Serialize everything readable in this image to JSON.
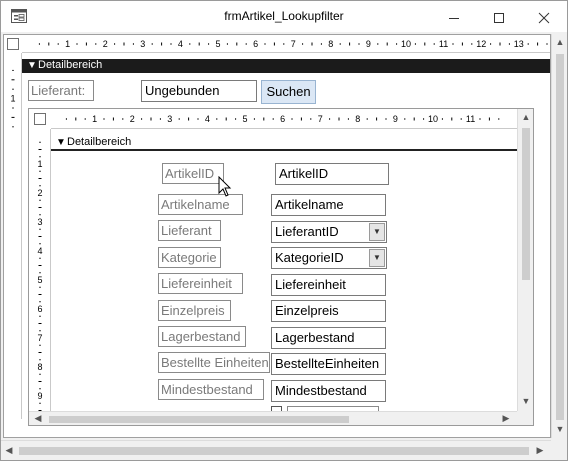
{
  "window": {
    "title": "frmArtikel_Lookupfilter",
    "app_icon": "form-icon",
    "minimize_icon": "minimize-icon",
    "maximize_icon": "maximize-icon",
    "close_icon": "close-icon"
  },
  "outer": {
    "section_label": "Detailbereich",
    "filter_label": "Lieferant:",
    "filter_value": "Ungebunden",
    "search_button": "Suchen",
    "ruler_numbers": [
      "1",
      "2",
      "3",
      "4",
      "5",
      "6",
      "7",
      "8",
      "9",
      "10",
      "11",
      "12",
      "13"
    ]
  },
  "subform": {
    "section_label": "Detailbereich",
    "ruler_numbers": [
      "1",
      "2",
      "3",
      "4",
      "5",
      "6",
      "7",
      "8",
      "9",
      "10",
      "11"
    ],
    "vertical_ruler_numbers": [
      "1",
      "2",
      "3",
      "4",
      "5",
      "6",
      "7",
      "8",
      "9"
    ],
    "fields": [
      {
        "label": "ArtikelID",
        "control": "ArtikelID",
        "type": "textbox"
      },
      {
        "label": "Artikelname",
        "control": "Artikelname",
        "type": "textbox"
      },
      {
        "label": "Lieferant",
        "control": "LieferantID",
        "type": "combobox"
      },
      {
        "label": "Kategorie",
        "control": "KategorieID",
        "type": "combobox"
      },
      {
        "label": "Liefereinheit",
        "control": "Liefereinheit",
        "type": "textbox"
      },
      {
        "label": "Einzelpreis",
        "control": "Einzelpreis",
        "type": "textbox"
      },
      {
        "label": "Lagerbestand",
        "control": "Lagerbestand",
        "type": "textbox"
      },
      {
        "label": "Bestellte Einheiten",
        "control": "BestellteEinheiten",
        "type": "textbox"
      },
      {
        "label": "Mindestbestand",
        "control": "Mindestbestand",
        "type": "textbox"
      }
    ]
  },
  "outer_vertical_ruler_numbers": [
    "1"
  ]
}
